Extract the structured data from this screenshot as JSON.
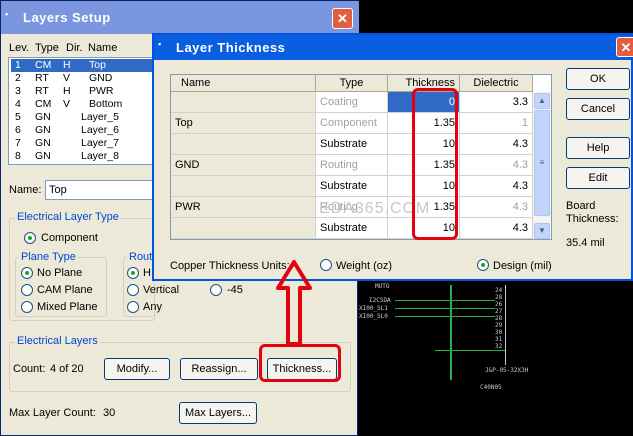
{
  "colors": {
    "title_blue": "#0a5fe0",
    "accent_red": "#e3000f",
    "pcb_green": "#27b34a"
  },
  "layers_setup": {
    "title": "Layers Setup",
    "headers": {
      "lev": "Lev.",
      "type": "Type",
      "dir": "Dir.",
      "name": "Name"
    },
    "rows": [
      {
        "lev": "1",
        "type": "CM",
        "dir": "H",
        "name": "Top"
      },
      {
        "lev": "2",
        "type": "RT",
        "dir": "V",
        "name": "GND"
      },
      {
        "lev": "3",
        "type": "RT",
        "dir": "H",
        "name": "PWR"
      },
      {
        "lev": "4",
        "type": "CM",
        "dir": "V",
        "name": "Bottom"
      },
      {
        "lev": "5",
        "type": "GN",
        "dir": "",
        "name": "Layer_5"
      },
      {
        "lev": "6",
        "type": "GN",
        "dir": "",
        "name": "Layer_6"
      },
      {
        "lev": "7",
        "type": "GN",
        "dir": "",
        "name": "Layer_7"
      },
      {
        "lev": "8",
        "type": "GN",
        "dir": "",
        "name": "Layer_8"
      }
    ],
    "name_label": "Name:",
    "name_value": "Top",
    "electrical_type_label": "Electrical  Layer Type",
    "component_option": "Component",
    "plane_type_label": "Plane Type",
    "plane_options": [
      "No Plane",
      "CAM Plane",
      "Mixed Plane"
    ],
    "routing_label": "Rout",
    "routing_options": [
      "H",
      "Vertical",
      "-45",
      "Any"
    ],
    "electrical_layers_label": "Electrical Layers",
    "count_label": "Count:",
    "count_value": "4 of 20",
    "modify_button": "Modify...",
    "reassign_button": "Reassign...",
    "thickness_button": "Thickness...",
    "max_layer_label": "Max Layer Count:",
    "max_layer_value": "30",
    "max_layers_button": "Max Layers..."
  },
  "thickness": {
    "title": "Layer Thickness",
    "headers": {
      "name": "Name",
      "type": "Type",
      "thickness": "Thickness",
      "dielectric": "Dielectric"
    },
    "rows": [
      {
        "name": "",
        "type": "Coating",
        "type_gray": true,
        "thickness": "0",
        "dielectric": "3.3",
        "diel_gray": false
      },
      {
        "name": "Top",
        "type": "Component",
        "type_gray": true,
        "thickness": "1.35",
        "dielectric": "1",
        "diel_gray": true
      },
      {
        "name": "",
        "type": "Substrate",
        "type_gray": false,
        "thickness": "10",
        "dielectric": "4.3",
        "diel_gray": false
      },
      {
        "name": "GND",
        "type": "Routing",
        "type_gray": true,
        "thickness": "1.35",
        "dielectric": "4.3",
        "diel_gray": true
      },
      {
        "name": "",
        "type": "Substrate",
        "type_gray": false,
        "thickness": "10",
        "dielectric": "4.3",
        "diel_gray": false
      },
      {
        "name": "PWR",
        "type": "Routing",
        "type_gray": true,
        "thickness": "1.35",
        "dielectric": "4.3",
        "diel_gray": true
      },
      {
        "name": "",
        "type": "Substrate",
        "type_gray": false,
        "thickness": "10",
        "dielectric": "4.3",
        "diel_gray": false
      }
    ],
    "ok_button": "OK",
    "cancel_button": "Cancel",
    "help_button": "Help",
    "edit_button": "Edit",
    "board_thickness_label": "Board Thickness:",
    "board_thickness_value": "35.4 mil",
    "units_label": "Copper Thickness Units:",
    "unit_weight": "Weight (oz)",
    "unit_design": "Design (mil)",
    "watermark": "EDA365.COM"
  },
  "schematic": {
    "labels": [
      "MUTO",
      "I2CSDA",
      "XI00_SL1",
      "XI00_SL0",
      "J&P-05-32X3H",
      "C40N05"
    ],
    "pins": [
      "24",
      "28",
      "26",
      "27",
      "28",
      "29",
      "30",
      "31",
      "32"
    ]
  }
}
